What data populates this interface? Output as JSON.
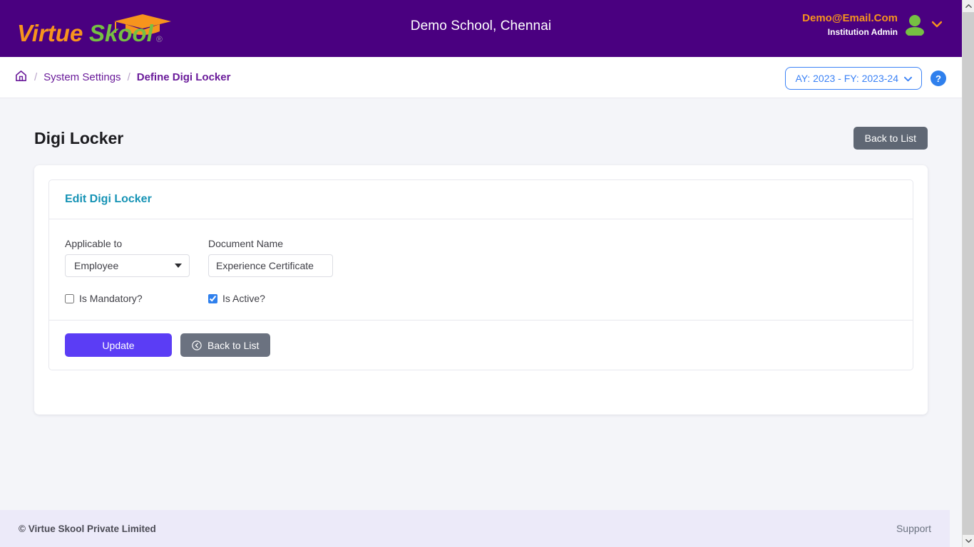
{
  "header": {
    "logo_text_a": "Virtue",
    "logo_text_b": "Skool",
    "logo_registered": "®",
    "school_title": "Demo School, Chennai",
    "user_email": "Demo@Email.Com",
    "user_role": "Institution Admin",
    "brand_orange": "#f7941d",
    "brand_green": "#76c043",
    "brand_purple": "#4a0080"
  },
  "breadcrumb": {
    "home_icon": "home-icon",
    "sep": "/",
    "items": [
      {
        "label": "System Settings"
      },
      {
        "label": "Define Digi Locker"
      }
    ],
    "academic_year": "AY: 2023 - FY: 2023-24",
    "help_label": "?"
  },
  "main": {
    "page_title": "Digi Locker",
    "back_to_list_top": "Back to List",
    "card": {
      "heading": "Edit Digi Locker",
      "fields": [
        {
          "label": "Applicable to",
          "type": "select",
          "value": "Employee"
        },
        {
          "label": "Document Name",
          "type": "text",
          "value": "Experience Certificate",
          "placeholder": ""
        }
      ],
      "checkboxes": [
        {
          "label": "Is Mandatory?",
          "checked": false
        },
        {
          "label": "Is Active?",
          "checked": true
        }
      ],
      "actions": {
        "update_label": "Update",
        "back_label": "Back to List"
      }
    }
  },
  "footer": {
    "copyright": "© Virtue Skool Private Limited",
    "support": "Support"
  }
}
